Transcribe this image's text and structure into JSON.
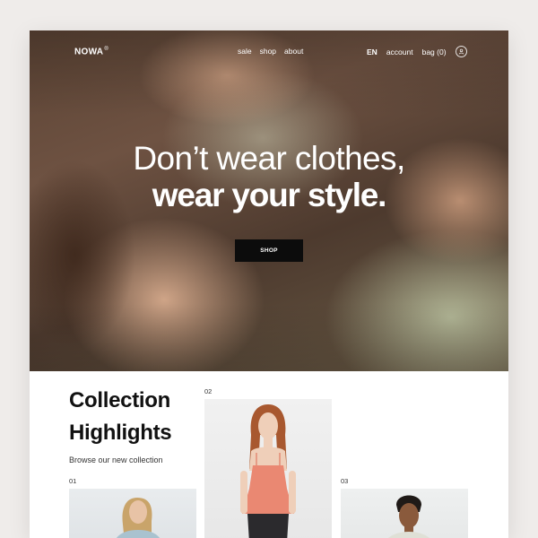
{
  "brand": {
    "logo": "NOWA",
    "logo_mark": "®"
  },
  "nav": {
    "left_links": [
      "sale",
      "shop",
      "about"
    ],
    "language": "EN",
    "account": "account",
    "bag": "bag (0)",
    "profile_icon": "user-icon"
  },
  "hero": {
    "headline_line1": "Don’t wear clothes,",
    "headline_line2": "wear your style.",
    "cta_label": "SHOP"
  },
  "collection": {
    "title_line1": "Collection",
    "title_line2": "Highlights",
    "subtitle": "Browse our new collection",
    "items": [
      {
        "number": "01"
      },
      {
        "number": "02"
      },
      {
        "number": "03"
      }
    ]
  },
  "colors": {
    "page_bg": "#efecea",
    "frame_bg": "#ffffff",
    "cta_bg": "#0c0c0c",
    "accent_top": "#f08a6e"
  }
}
